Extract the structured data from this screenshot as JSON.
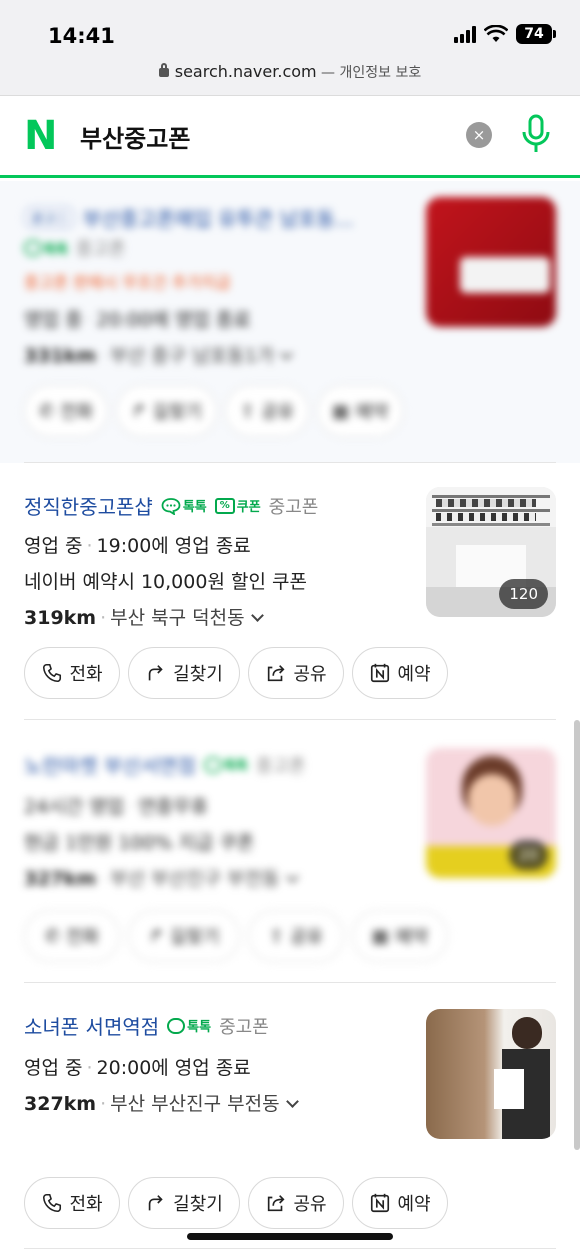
{
  "status": {
    "time": "14:41",
    "battery": "74"
  },
  "browser": {
    "domain": "search.naver.com",
    "separator": " — ",
    "privacy": "개인정보 보호"
  },
  "search": {
    "logo": "N",
    "query": "부산중고폰",
    "clear_icon": "×",
    "mic_icon": "mic-icon"
  },
  "colors": {
    "naver_green": "#03c75a",
    "link_blue": "#1e4ca0"
  },
  "results": [
    {
      "title": "부산중고폰매입 유투큰 남포동...",
      "ad_label": "광고ⓘ",
      "badge": "톡톡",
      "category": "중고폰",
      "promo": "중고폰 판매시 무조건 추가지급",
      "hours_status": "영업 중",
      "hours_detail": "20:00에 영업 종료",
      "distance": "331km",
      "location": "부산 중구 남포동1가",
      "actions": [
        "전화",
        "길찾기",
        "공유",
        "예약"
      ]
    },
    {
      "title": "정직한중고폰샵",
      "badge_talk": "톡톡",
      "badge_coupon": "쿠폰",
      "category": "중고폰",
      "hours_status": "영업 중",
      "hours_detail": "19:00에 영업 종료",
      "promo": "네이버 예약시 10,000원 할인 쿠폰",
      "distance": "319km",
      "location": "부산 북구 덕천동",
      "photo_count": "120",
      "actions": [
        "전화",
        "길찾기",
        "공유",
        "예약"
      ]
    },
    {
      "title": "노란마켓 부산서면점",
      "badge": "톡톡",
      "category": "중고폰",
      "hours_status": "24시간 영업",
      "hours_detail": "연중무휴",
      "promo": "현금 1만원 100% 지급 쿠폰",
      "distance": "327km",
      "location": "부산 부산진구 부전동",
      "photo_count": "20",
      "actions": [
        "전화",
        "길찾기",
        "공유",
        "예약"
      ]
    },
    {
      "title": "소녀폰 서면역점",
      "badge": "톡톡",
      "category": "중고폰",
      "hours_status": "영업 중",
      "hours_detail": "20:00에 영업 종료",
      "distance": "327km",
      "location": "부산 부산진구 부전동",
      "actions": [
        "전화",
        "길찾기",
        "공유",
        "예약"
      ]
    }
  ]
}
